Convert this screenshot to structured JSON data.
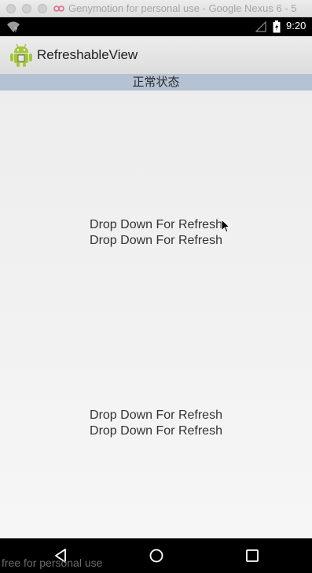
{
  "window": {
    "title": "Genymotion for personal use - Google Nexus 6 - 5",
    "logo_icon": "genymotion-logo-icon"
  },
  "status_bar": {
    "time": "9:20",
    "icons": [
      "wifi-icon",
      "signal-icon",
      "battery-icon"
    ]
  },
  "action_bar": {
    "app_name": "RefreshableView",
    "app_icon": "android-icon"
  },
  "refresh_header": {
    "status_text": "正常状态"
  },
  "content": {
    "blocks": [
      [
        "Drop Down For Refresh",
        "Drop Down For Refresh"
      ],
      [
        "Drop Down For Refresh",
        "Drop Down For Refresh"
      ]
    ]
  },
  "nav_bar": {
    "icons": [
      "back-icon",
      "home-icon",
      "recent-apps-icon"
    ]
  },
  "watermark": "free for personal use",
  "colors": {
    "header_background": "#b4c2d3",
    "bar_background": "#000000",
    "android_green": "#a4c639"
  }
}
